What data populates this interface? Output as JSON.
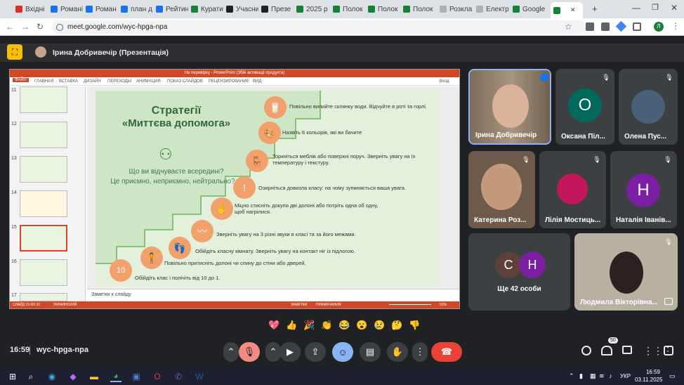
{
  "tabs": [
    {
      "label": "Вхідні",
      "color": "#d93025"
    },
    {
      "label": "Романі",
      "color": "#1a73e8"
    },
    {
      "label": "Роман",
      "color": "#1a73e8"
    },
    {
      "label": "план д",
      "color": "#1a73e8"
    },
    {
      "label": "Рейтин",
      "color": "#1a73e8"
    },
    {
      "label": "Курати",
      "color": "#188038"
    },
    {
      "label": "Учасни",
      "color": "#202124"
    },
    {
      "label": "Презе",
      "color": "#202124"
    },
    {
      "label": "2025 р",
      "color": "#188038"
    },
    {
      "label": "Полок",
      "color": "#188038"
    },
    {
      "label": "Полок",
      "color": "#188038"
    },
    {
      "label": "Полок",
      "color": "#188038"
    },
    {
      "label": "Розкла",
      "color": "#b0b0b0"
    },
    {
      "label": "Електр",
      "color": "#b0b0b0"
    },
    {
      "label": "Google",
      "color": "#188038"
    },
    {
      "label": "",
      "color": "#188038"
    }
  ],
  "url": "meet.google.com/wyc-hpga-npa",
  "presenter": "Ірина Добривечір (Презентація)",
  "ppt": {
    "title": "На перевірку - PowerPoint (Збій активаціі продукта)",
    "menu": [
      "ФАЙЛ",
      "ГЛАВНАЯ",
      "ВСТАВКА",
      "ДИЗАЙН",
      "ПЕРЕХОДЫ",
      "АНИМАЦИЯ",
      "ПОКАЗ СЛАЙДОВ",
      "РЕЦЕНЗИРОВАНИЕ",
      "ВИД"
    ],
    "login": "Вход",
    "slide_numbers": [
      "11",
      "12",
      "13",
      "14",
      "15",
      "16",
      "17"
    ],
    "notes": "Заметки к слайду",
    "status_left": "СЛАЙД 15 ИЗ 22",
    "status_lang": "УКРАИНСКИЙ",
    "status_notes": "ЗАМЕТКИ",
    "status_comments": "ПРИМЕЧАНИЯ",
    "zoom": "52%"
  },
  "slide": {
    "title_line1": "Стратегії",
    "title_line2": "«Миттєва допомога»",
    "question1": "Що ви відчуваєте всередині?",
    "question2": "Це приємно, неприємно, нейтрально?",
    "steps": [
      "Повільно випийте склянку води. Відчуйте в роті та горлі.",
      "Назвіть 6 кольорів, які ви бачите",
      "Торкніться меблів або поверхні поруч. Зверніть увагу на їх температуру і текстуру.",
      "Озирніться довкола класу: на чому зупиняється ваша увага.",
      "Міцно стисніть докупи дві долоні або потріть одна об одну, щоб нагрілися.",
      "Зверніть увагу на 3 різні звуки в класі та за його межами.",
      "Обійдіть класну кімнату. Зверніть увагу на контакт ніг із підлогою.",
      "Повільно притисніть долоні чи спину до стіни або дверей.",
      "Обійдіть клас і полічіть від 10 до 1."
    ],
    "number_badge": "10"
  },
  "participants": [
    {
      "name": "Ірина Добривечір",
      "type": "video"
    },
    {
      "name": "Оксана Піл...",
      "initial": "О",
      "color": "#00695c"
    },
    {
      "name": "Олена Пус...",
      "type": "photo"
    },
    {
      "name": "Катерина Роз...",
      "type": "video"
    },
    {
      "name": "Лілія Мостиць...",
      "type": "photo"
    },
    {
      "name": "Наталія Іванів...",
      "initial": "Н",
      "color": "#7b1fa2"
    },
    {
      "name": "Ще 42 особи",
      "initials": [
        "С",
        "Н"
      ]
    },
    {
      "name": "Людмила Вікторівна...",
      "type": "video"
    }
  ],
  "emojis": [
    "💖",
    "👍",
    "🎉",
    "👏",
    "😂",
    "😮",
    "😢",
    "🤔",
    "👎"
  ],
  "time": "16:59",
  "meeting_code": "wyc-hpga-npa",
  "people_badge": "50",
  "taskbar": {
    "lang": "УКР",
    "time": "16:59",
    "date": "03.11.2025"
  }
}
